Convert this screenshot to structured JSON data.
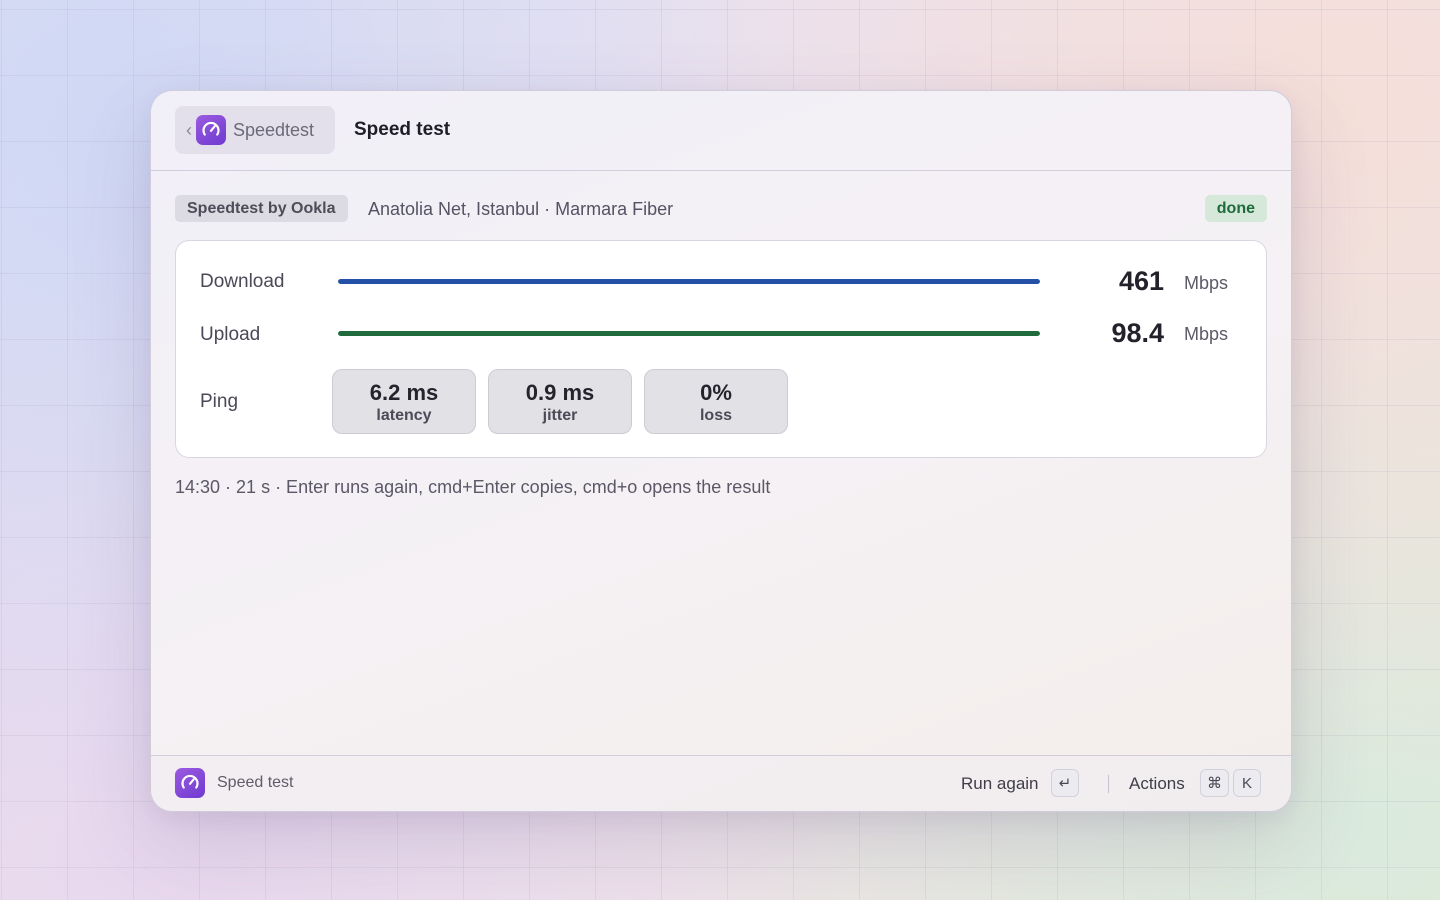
{
  "header": {
    "back_label": "Speedtest",
    "title": "Speed test"
  },
  "meta": {
    "provider": "Speedtest by Ookla",
    "server": "Anatolia Net, Istanbul · Marmara Fiber",
    "status": "done"
  },
  "results": {
    "download": {
      "label": "Download",
      "value": "461",
      "unit": "Mbps",
      "progress": 1.0,
      "color": "#2450a8"
    },
    "upload": {
      "label": "Upload",
      "value": "98.4",
      "unit": "Mbps",
      "progress": 1.0,
      "color": "#1f6b3c"
    },
    "ping": {
      "label": "Ping",
      "stats": [
        {
          "value": "6.2 ms",
          "caption": "latency"
        },
        {
          "value": "0.9 ms",
          "caption": "jitter"
        },
        {
          "value": "0%",
          "caption": "loss"
        }
      ]
    }
  },
  "footnote": "14:30 · 21 s · Enter runs again, cmd+Enter copies, cmd+o opens the result",
  "footer": {
    "title": "Speed test",
    "primary_action": "Run again",
    "primary_key": "↵",
    "actions_label": "Actions",
    "actions_keys": [
      "⌘",
      "K"
    ]
  },
  "icons": {
    "app": "gauge-icon",
    "back": "chevron-left-icon"
  },
  "colors": {
    "accent": "#7c44d8",
    "download": "#2450a8",
    "upload": "#1f6b3c",
    "status_bg": "#d5e8da",
    "status_fg": "#1f6b3c"
  }
}
